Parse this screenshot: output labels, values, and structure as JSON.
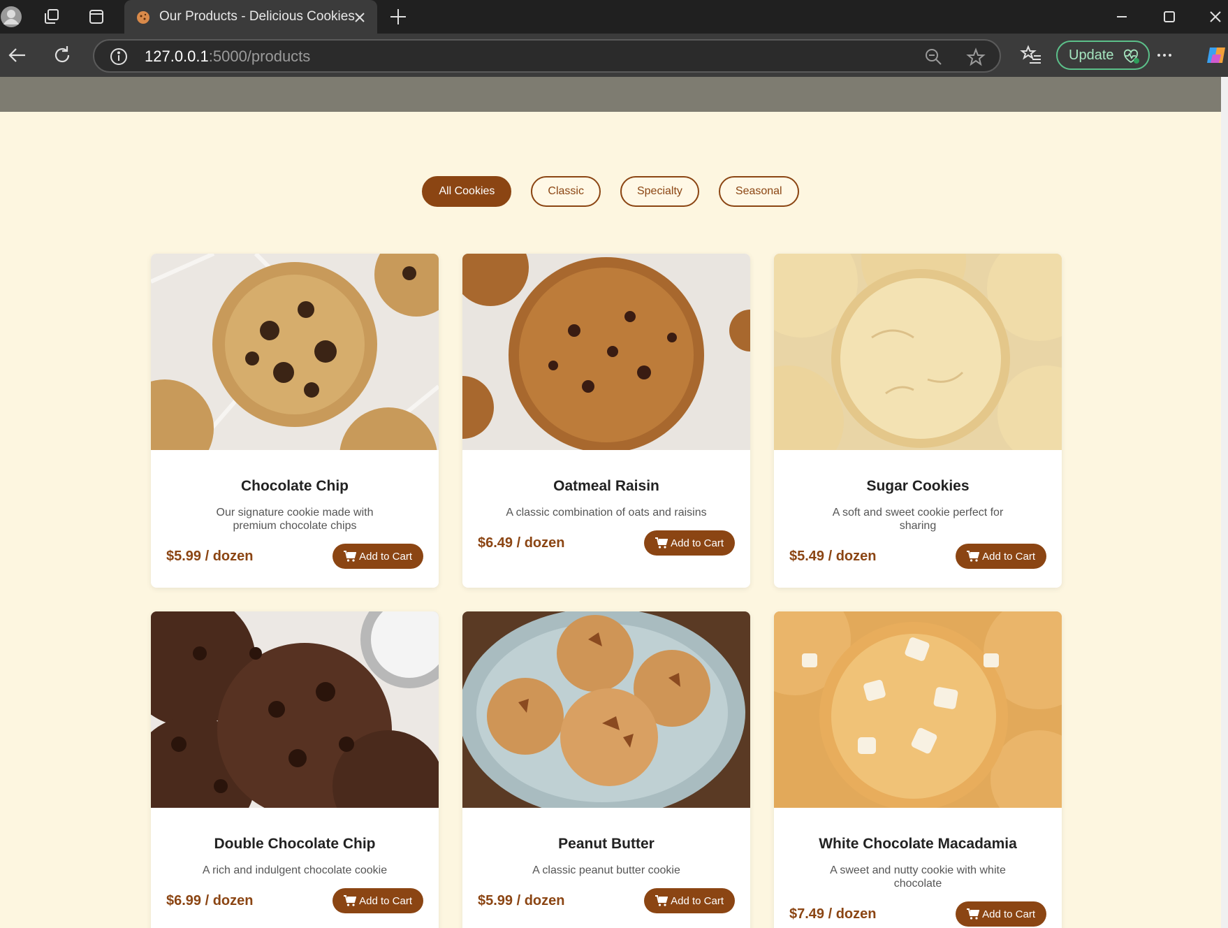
{
  "browser": {
    "tab_title": "Our Products - Delicious Cookies",
    "url_host": "127.0.0.1",
    "url_path": ":5000/products",
    "update_label": "Update"
  },
  "filters": [
    {
      "label": "All Cookies",
      "active": true
    },
    {
      "label": "Classic",
      "active": false
    },
    {
      "label": "Specialty",
      "active": false
    },
    {
      "label": "Seasonal",
      "active": false
    }
  ],
  "add_to_cart_label": "Add to Cart",
  "products": [
    {
      "name": "Chocolate Chip",
      "description": "Our signature cookie made with premium chocolate chips",
      "price": "$5.99 / dozen",
      "image": "chocolate-chip-cookie-photo"
    },
    {
      "name": "Oatmeal Raisin",
      "description": "A classic combination of oats and raisins",
      "price": "$6.49 / dozen",
      "image": "oatmeal-raisin-cookie-photo"
    },
    {
      "name": "Sugar Cookies",
      "description": "A soft and sweet cookie perfect for sharing",
      "price": "$5.49 / dozen",
      "image": "sugar-cookie-photo"
    },
    {
      "name": "Double Chocolate Chip",
      "description": "A rich and indulgent chocolate cookie",
      "price": "$6.99 / dozen",
      "image": "double-chocolate-cookie-photo"
    },
    {
      "name": "Peanut Butter",
      "description": "A classic peanut butter cookie",
      "price": "$5.99 / dozen",
      "image": "peanut-butter-cookie-photo"
    },
    {
      "name": "White Chocolate Macadamia",
      "description": "A sweet and nutty cookie with white chocolate",
      "price": "$7.49 / dozen",
      "image": "white-chocolate-macadamia-cookie-photo"
    }
  ],
  "colors": {
    "brand": "#8b4513",
    "page_bg": "#fdf6e0",
    "header_bar": "#7e7c71"
  }
}
